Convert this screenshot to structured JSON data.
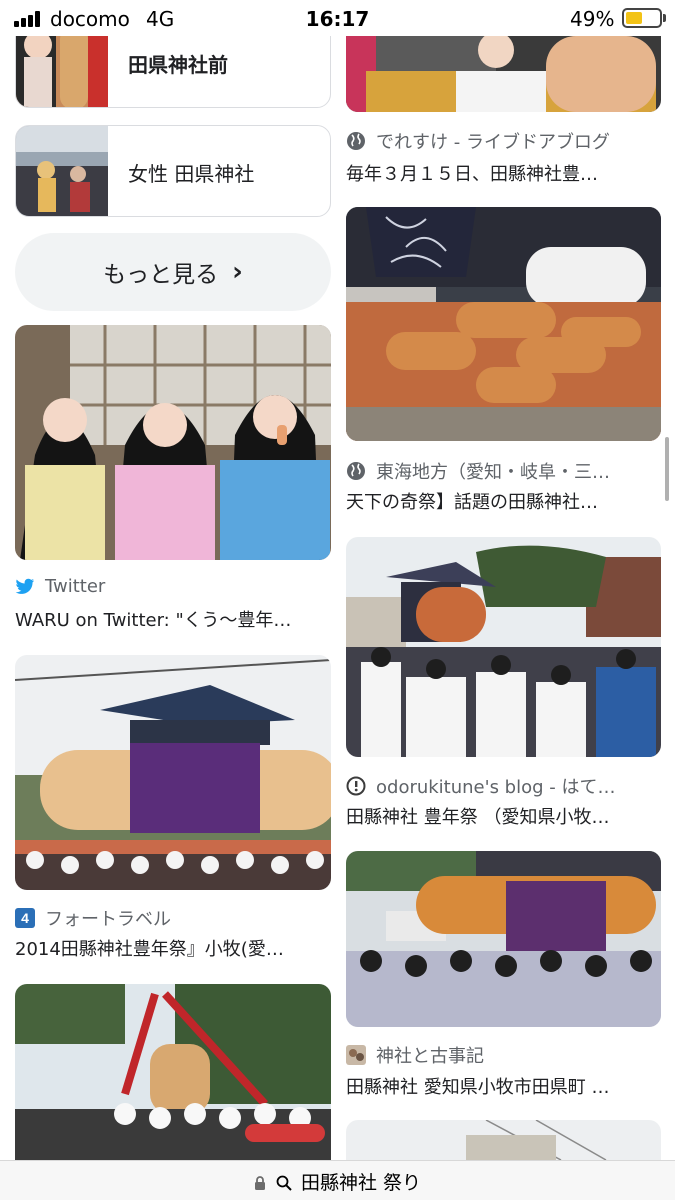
{
  "status_bar": {
    "carrier": "docomo",
    "network": "4G",
    "time": "16:17",
    "battery_percent": "49%",
    "battery_level": 0.49,
    "battery_color": "#f3c316"
  },
  "related_searches": [
    {
      "label": "田県神社前"
    },
    {
      "label": "女性 田県神社"
    }
  ],
  "more_button": {
    "label": "もっと見る",
    "icon": "chevron-right-icon"
  },
  "results_left": [
    {
      "source": "Twitter",
      "source_icon": "twitter-bird-icon",
      "title": "WARU on Twitter: \"くう〜豊年…"
    },
    {
      "source": "フォートラベル",
      "source_icon": "4travel-icon",
      "title": "2014田縣神社豊年祭』小牧(愛…"
    }
  ],
  "results_right": [
    {
      "source": "でれすけ - ライブドアブログ",
      "source_icon": "globe-icon",
      "title": "毎年３月１５日、田縣神社豊…"
    },
    {
      "source": "東海地方（愛知・岐阜・三…",
      "source_icon": "globe-icon",
      "title": "天下の奇祭】話題の田縣神社…"
    },
    {
      "source": "odorukitune's blog - はて…",
      "source_icon": "hatena-icon",
      "title": "田縣神社 豊年祭 （愛知県小牧…"
    },
    {
      "source": "神社と古事記",
      "source_icon": "site-favicon-icon",
      "title": "田縣神社 愛知県小牧市田県町 …"
    }
  ],
  "address_bar": {
    "text": "田縣神社 祭り",
    "lock_icon": "lock-icon",
    "search_icon": "search-icon"
  },
  "colors": {
    "twitter_blue": "#1da1f2",
    "fourtravel_blue": "#2b6fb7",
    "chip_border": "#dadce0",
    "button_bg": "#f1f3f4"
  }
}
